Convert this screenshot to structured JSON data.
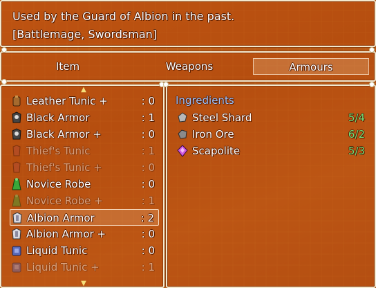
{
  "help": {
    "description": "Used by the Guard of Albion in the past.",
    "classes": "[Battlemage, Swordsman]"
  },
  "tabs": [
    {
      "label": "Item",
      "selected": false
    },
    {
      "label": "Weapons",
      "selected": false
    },
    {
      "label": "Armours",
      "selected": true
    }
  ],
  "items": [
    {
      "name": "Leather Tunic +",
      "qty": ": 0",
      "icon": "leather-tunic-icon",
      "enabled": true,
      "selected": false
    },
    {
      "name": "Black Armor",
      "qty": ": 1",
      "icon": "black-armor-icon",
      "enabled": true,
      "selected": false
    },
    {
      "name": "Black Armor +",
      "qty": ": 0",
      "icon": "black-armor-icon",
      "enabled": true,
      "selected": false
    },
    {
      "name": "Thief's Tunic",
      "qty": ": 1",
      "icon": "thief-tunic-icon",
      "enabled": false,
      "selected": false
    },
    {
      "name": "Thief's Tunic +",
      "qty": ": 0",
      "icon": "thief-tunic-icon",
      "enabled": false,
      "selected": false
    },
    {
      "name": "Novice Robe",
      "qty": ": 0",
      "icon": "novice-robe-icon",
      "enabled": true,
      "selected": false
    },
    {
      "name": "Novice Robe +",
      "qty": ": 1",
      "icon": "novice-robe-icon",
      "enabled": false,
      "selected": false
    },
    {
      "name": "Albion Armor",
      "qty": ": 2",
      "icon": "albion-armor-icon",
      "enabled": true,
      "selected": true
    },
    {
      "name": "Albion Armor +",
      "qty": ": 0",
      "icon": "albion-armor-icon",
      "enabled": true,
      "selected": false
    },
    {
      "name": "Liquid Tunic",
      "qty": ": 0",
      "icon": "liquid-tunic-icon",
      "enabled": true,
      "selected": false
    },
    {
      "name": "Liquid Tunic +",
      "qty": ": 1",
      "icon": "liquid-tunic-icon",
      "enabled": false,
      "selected": false
    }
  ],
  "ingredients": {
    "heading": "Ingredients",
    "rows": [
      {
        "name": "Steel Shard",
        "count": "5/4",
        "icon": "steel-shard-icon"
      },
      {
        "name": "Iron Ore",
        "count": "6/2",
        "icon": "iron-ore-icon"
      },
      {
        "name": "Scapolite",
        "count": "5/3",
        "icon": "scapolite-gem-icon"
      }
    ]
  },
  "colors": {
    "window_border": "#f3e9cf",
    "heading_blue": "#9fc4ff",
    "count_green": "#6fe07a"
  }
}
